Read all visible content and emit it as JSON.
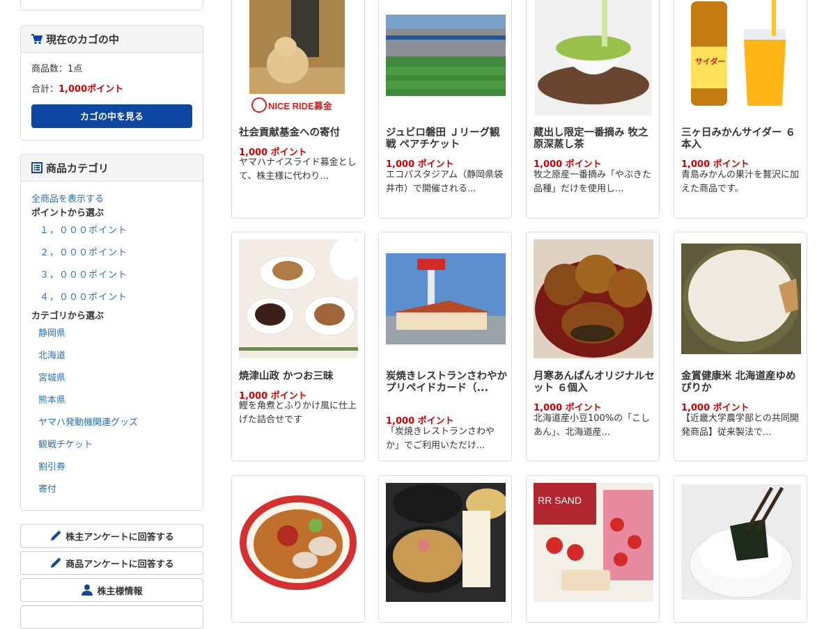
{
  "cart": {
    "title": "現在のカゴの中",
    "count_label": "商品数：1点",
    "total_prefix": "合計：",
    "total_points": "1,000ポイント",
    "view_button": "カゴの中を見る"
  },
  "categories": {
    "title": "商品カテゴリ",
    "all_link": "全商品を表示する",
    "by_points_heading": "ポイントから選ぶ",
    "point_items": [
      "１，０００ポイント",
      "２，０００ポイント",
      "３，０００ポイント",
      "４，０００ポイント"
    ],
    "by_category_heading": "カテゴリから選ぶ",
    "category_items": [
      "静岡県",
      "北海道",
      "宮城県",
      "熊本県",
      "ヤマハ発動機関連グッズ",
      "観戦チケット",
      "割引券",
      "寄付"
    ]
  },
  "side_buttons": {
    "shareholder_survey": "株主アンケートに回答する",
    "product_survey": "商品アンケートに回答する",
    "shareholder_info": "株主様情報"
  },
  "products": [
    {
      "title": "社会貢献基金への寄付",
      "price": "1,000 ポイント",
      "desc": "ヤマハナイスライド募金として、株主様に代わり...",
      "image_text": "NICE RIDE募金"
    },
    {
      "title": "ジュビロ磐田 Ｊリーグ観戦 ペアチケット",
      "price": "1,000 ポイント",
      "desc": "エコパスタジアム（静岡県袋井市）で開催される..."
    },
    {
      "title": "蔵出し限定一番摘み 牧之原深蒸し茶",
      "price": "1,000 ポイント",
      "desc": "牧之原産一番摘み「やぶきた品種」だけを使用し..."
    },
    {
      "title": "三ヶ日みかんサイダー ６本入",
      "price": "1,000 ポイント",
      "desc": "青島みかんの果汁を贅沢に加えた商品です。",
      "image_text": "サイダー"
    },
    {
      "title": "焼津山政 かつお三昧",
      "price": "1,000 ポイント",
      "desc": "鰹を角煮とふりかけ風に仕上げた詰合せです"
    },
    {
      "title": "炭焼きレストランさわやか プリペイドカード（...",
      "price": "1,000 ポイント",
      "desc": "「炭焼きレストランさわやか」でご利用いただけ..."
    },
    {
      "title": "月寒あんぱんオリジナルセット ６個入",
      "price": "1,000 ポイント",
      "desc": "北海道産小豆100%の「こしあん」、北海道産..."
    },
    {
      "title": "金賞健康米 北海道産ゆめぴりか",
      "price": "1,000 ポイント",
      "desc": "【近畿大学農学部との共同開発商品】従来製法で..."
    },
    {
      "title": "",
      "price": "",
      "desc": ""
    },
    {
      "title": "",
      "price": "",
      "desc": ""
    },
    {
      "title": "",
      "price": "",
      "desc": "",
      "image_text": "RR SAND"
    },
    {
      "title": "",
      "price": "",
      "desc": ""
    }
  ],
  "colors": {
    "accent_blue": "#0d47a1",
    "price_red": "#cc0000",
    "link_blue": "#2a6fb0"
  },
  "icons": {
    "cart": "shopping-cart-icon",
    "category": "list-icon",
    "survey": "pencil-icon",
    "user": "user-icon"
  }
}
